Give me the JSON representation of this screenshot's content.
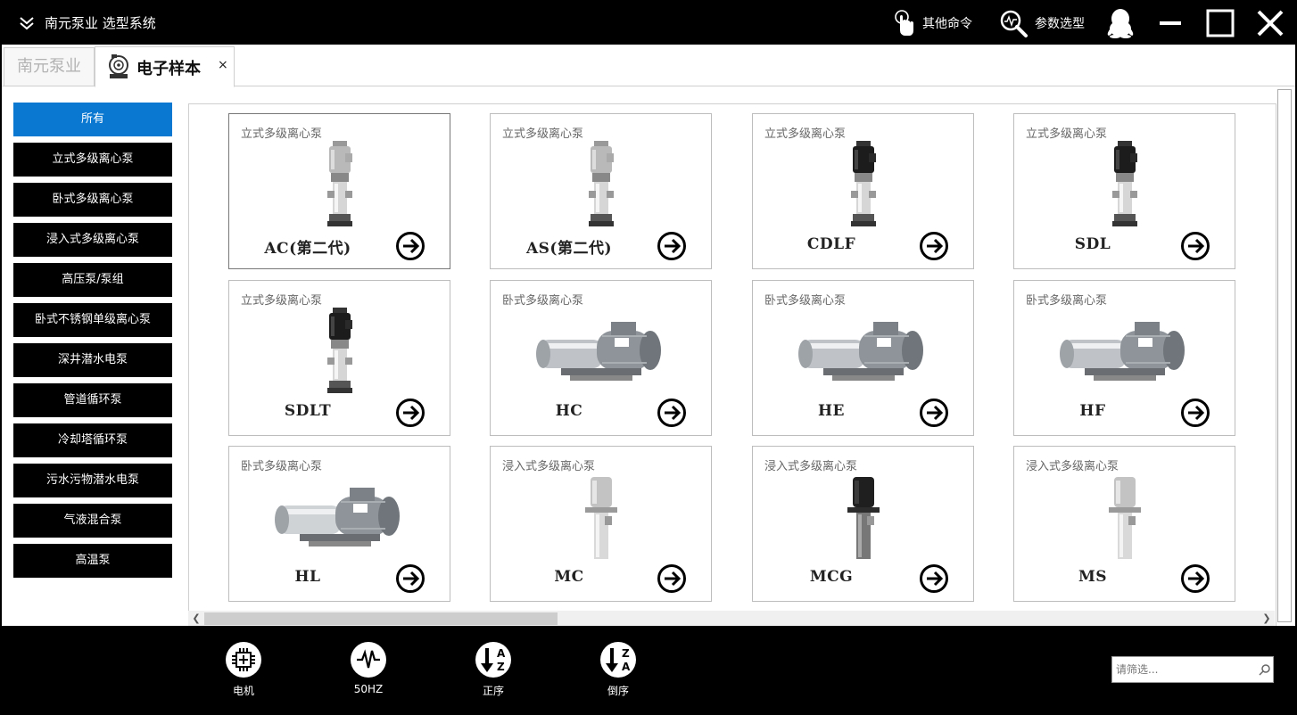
{
  "app": {
    "title": "南元泵业 选型系统"
  },
  "toolbar": {
    "other_cmd": "其他命令",
    "param_select": "参数选型"
  },
  "tabs": {
    "home": "南元泵业",
    "active": "电子样本",
    "close": "×"
  },
  "sidebar": {
    "items": [
      {
        "label": "所有",
        "active": true
      },
      {
        "label": "立式多级离心泵"
      },
      {
        "label": "卧式多级离心泵"
      },
      {
        "label": "浸入式多级离心泵"
      },
      {
        "label": "高压泵/泵组"
      },
      {
        "label": "卧式不锈钢单级离心泵"
      },
      {
        "label": "深井潜水电泵"
      },
      {
        "label": "管道循环泵"
      },
      {
        "label": "冷却塔循环泵"
      },
      {
        "label": "污水污物潜水电泵"
      },
      {
        "label": "气液混合泵"
      },
      {
        "label": "高温泵"
      }
    ]
  },
  "products": [
    {
      "category": "立式多级离心泵",
      "model": "AC(第二代)",
      "image": "vertical-pump-silver"
    },
    {
      "category": "立式多级离心泵",
      "model": "AS(第二代)",
      "image": "vertical-pump-silver"
    },
    {
      "category": "立式多级离心泵",
      "model": "CDLF",
      "image": "vertical-pump-black"
    },
    {
      "category": "立式多级离心泵",
      "model": "SDL",
      "image": "vertical-pump-black"
    },
    {
      "category": "立式多级离心泵",
      "model": "SDLT",
      "image": "vertical-pump-black"
    },
    {
      "category": "卧式多级离心泵",
      "model": "HC",
      "image": "horizontal-pump"
    },
    {
      "category": "卧式多级离心泵",
      "model": "HE",
      "image": "horizontal-pump"
    },
    {
      "category": "卧式多级离心泵",
      "model": "HF",
      "image": "horizontal-pump"
    },
    {
      "category": "卧式多级离心泵",
      "model": "HL",
      "image": "horizontal-pump-shiny"
    },
    {
      "category": "浸入式多级离心泵",
      "model": "MC",
      "image": "immersion-pump-silver"
    },
    {
      "category": "浸入式多级离心泵",
      "model": "MCG",
      "image": "immersion-pump-black"
    },
    {
      "category": "浸入式多级离心泵",
      "model": "MS",
      "image": "immersion-pump-silver"
    }
  ],
  "footer": {
    "buttons": [
      {
        "label": "电机",
        "icon": "chip-icon"
      },
      {
        "label": "50HZ",
        "icon": "waveform-icon"
      },
      {
        "label": "正序",
        "icon": "sort-ascending-icon"
      },
      {
        "label": "倒序",
        "icon": "sort-descending-icon"
      }
    ],
    "search_placeholder": "请筛选..."
  }
}
